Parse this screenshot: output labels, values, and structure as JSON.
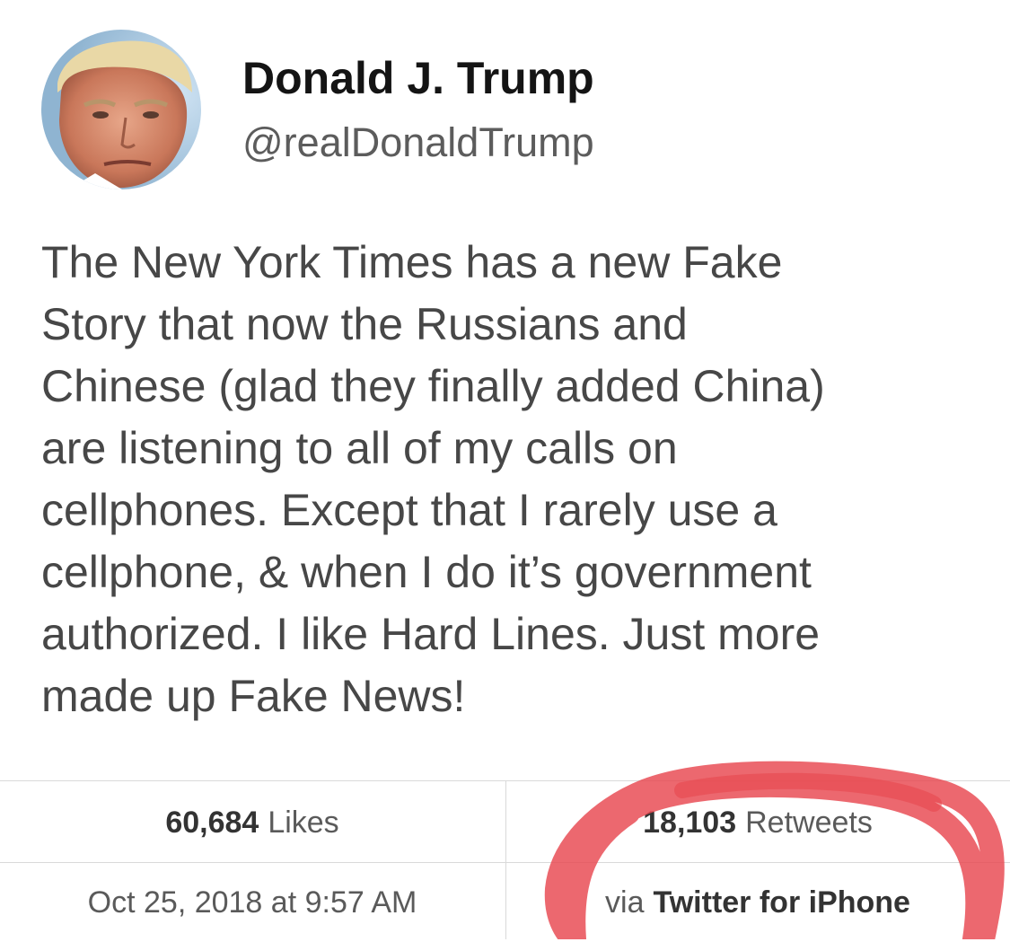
{
  "user": {
    "display_name": "Donald J. Trump",
    "handle": "@realDonaldTrump",
    "avatar_icon": "profile-photo"
  },
  "tweet": {
    "text": "The New York Times has a new Fake\nStory that now the Russians and\nChinese (glad they finally added China)\nare listening to all of my calls on\ncellphones. Except that I rarely use a\ncellphone, & when I do it’s government\nauthorized. I like Hard Lines. Just more\nmade up Fake News!"
  },
  "stats": {
    "likes_count": "60,684",
    "likes_label": "Likes",
    "retweets_count": "18,103",
    "retweets_label": "Retweets"
  },
  "meta": {
    "timestamp": "Oct 25, 2018 at 9:57 AM",
    "via_label": "via",
    "source": "Twitter for iPhone"
  },
  "colors": {
    "annotation_red": "#e8474f"
  }
}
